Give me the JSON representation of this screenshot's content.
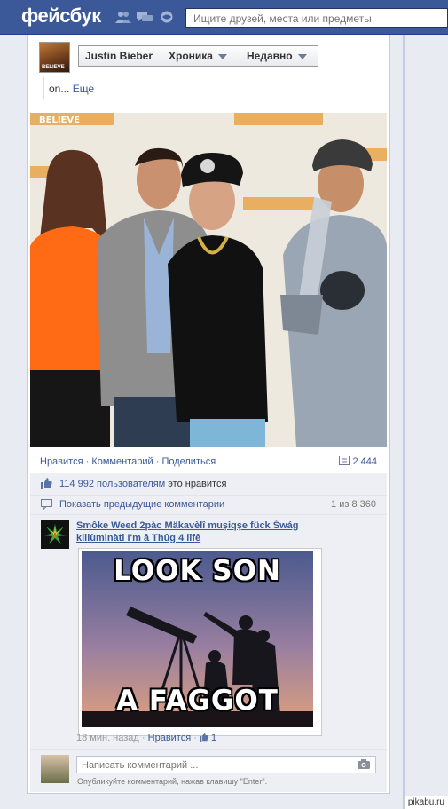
{
  "topbar": {
    "logo": "фейсбук",
    "search_placeholder": "Ищите друзей, места или предметы"
  },
  "header": {
    "profile_name": "Justin Bieber",
    "avatar_caption": "BELIEVE",
    "timeline_label": "Хроника",
    "sort_label": "Недавно"
  },
  "post": {
    "prev_text": "on...",
    "more_link": "Еще",
    "photo_banner_word": "BELIEVE",
    "actions": {
      "like": "Нравится",
      "comment": "Комментарий",
      "share": "Поделиться",
      "separator": "·"
    },
    "share_count": "2 444",
    "likes_count": "114 992 пользователям",
    "likes_suffix": " это нравится",
    "show_previous": "Показать предыдущие комментарии",
    "comments_position": "1 из 8 360"
  },
  "comment": {
    "author": "Smôke Weed 2pàc Mäkavèlî mușiqșe fück Šwág killùminàti I'm â Thûg 4 lîfê",
    "meme_top": "LOOK SON",
    "meme_bottom": "A FAGGOT",
    "time": "18 мин. назад",
    "like_link": "Нравится",
    "like_count": "1"
  },
  "composer": {
    "placeholder": "Написать комментарий ...",
    "hint": "Опубликуйте комментарий, нажав клавишу \"Enter\"."
  },
  "watermark": "pikabu.ru",
  "colors": {
    "brand": "#3b5998",
    "background": "#e9ebf2",
    "ufi": "#edeff4"
  }
}
